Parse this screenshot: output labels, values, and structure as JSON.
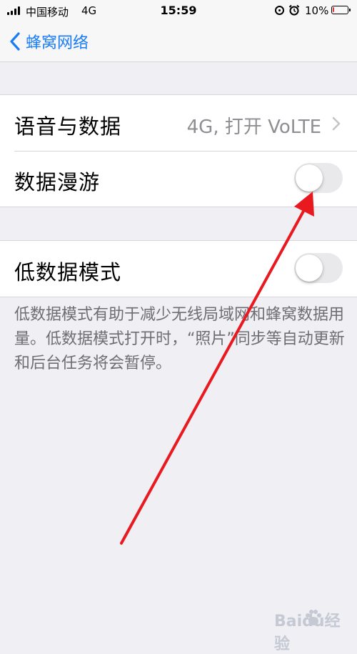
{
  "status_bar": {
    "carrier": "中国移动",
    "network": "4G",
    "time": "15:59",
    "battery_percent": "10%",
    "battery_level": 0.1,
    "icons": [
      "signal-icon",
      "orientation-lock-icon",
      "alarm-icon",
      "battery-icon"
    ]
  },
  "nav": {
    "back_label": "蜂窝网络",
    "back_icon": "chevron-left-icon"
  },
  "group1": {
    "rows": [
      {
        "label": "语音与数据",
        "value": "4G, 打开 VoLTE",
        "icon": "chevron-right-icon"
      },
      {
        "label": "数据漫游",
        "toggle_on": false
      }
    ]
  },
  "group2": {
    "rows": [
      {
        "label": "低数据模式",
        "toggle_on": false
      }
    ],
    "footnote": "低数据模式有助于减少无线局域网和蜂窝数据用量。低数据模式打开时，“照片”同步等自动更新和后台任务将会暂停。"
  },
  "colors": {
    "accent": "#1a7cf5",
    "background": "#efeff4",
    "arrow": "#e8191f",
    "toggle_off": "#e9e9eb"
  },
  "watermark": {
    "text": "Baidu经验",
    "icon": "baidu-paw-icon"
  }
}
